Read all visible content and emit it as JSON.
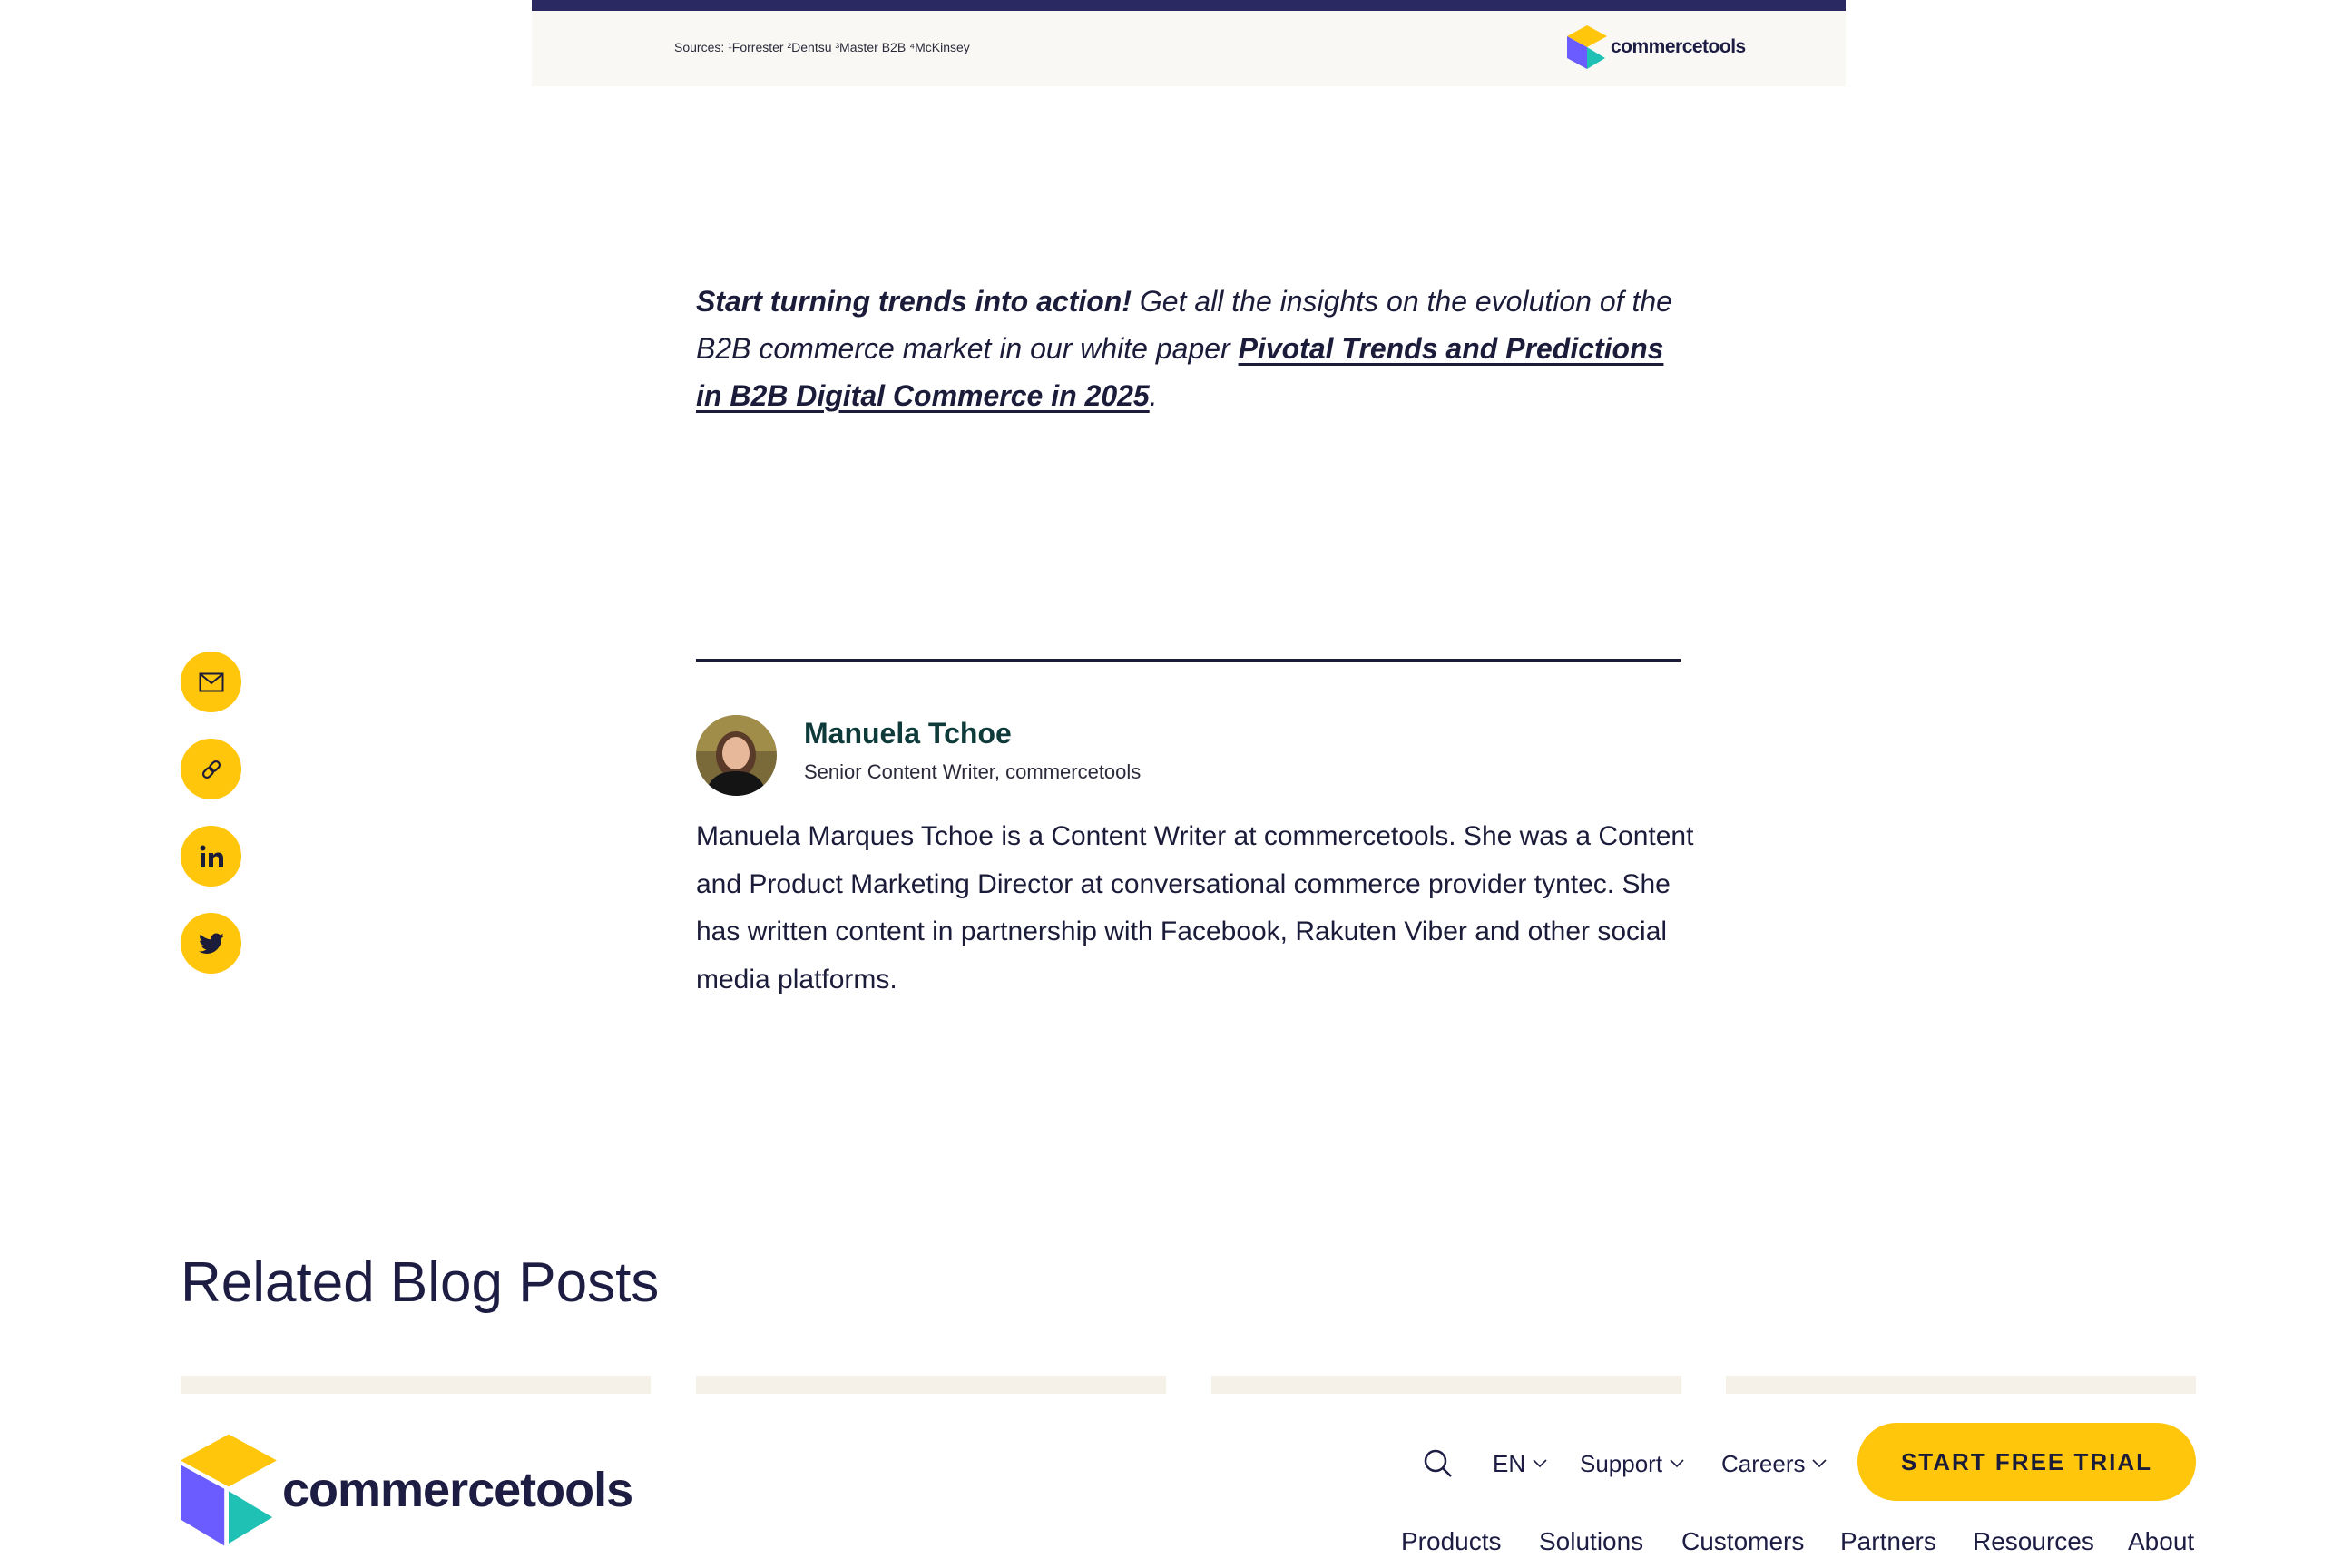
{
  "infobox": {
    "sources": "Sources: ¹Forrester ²Dentsu ³Master B2B ⁴McKinsey",
    "brand": "commercetools"
  },
  "cta": {
    "lead": "Start turning trends into action!",
    "text": " Get all the insights on the evolution of the B2B commerce market in our white paper ",
    "link": "Pivotal Trends and Predictions in B2B Digital Commerce in 2025",
    "end": "."
  },
  "share": {
    "items": [
      "email-icon",
      "link-icon",
      "linkedin-icon",
      "twitter-icon"
    ],
    "color": "#ffc60b"
  },
  "author": {
    "name": "Manuela Tchoe",
    "role": "Senior Content Writer, commercetools",
    "bio": "Manuela Marques Tchoe is a Content Writer at commercetools. She was a Content and Product Marketing Director at conversational commerce provider tyntec. She has written content in partnership with Facebook, Rakuten Viber and other social media platforms."
  },
  "related": {
    "title": "Related Blog Posts"
  },
  "header": {
    "brand": "commercetools",
    "language": "EN",
    "support": "Support",
    "careers": "Careers",
    "cta": "START FREE TRIAL",
    "nav": [
      "Products",
      "Solutions",
      "Customers",
      "Partners",
      "Resources",
      "About"
    ]
  },
  "colors": {
    "accent": "#ffc60b",
    "navy": "#1d1d44",
    "logo_purple": "#6a5cff",
    "logo_teal": "#1fc1b4"
  }
}
